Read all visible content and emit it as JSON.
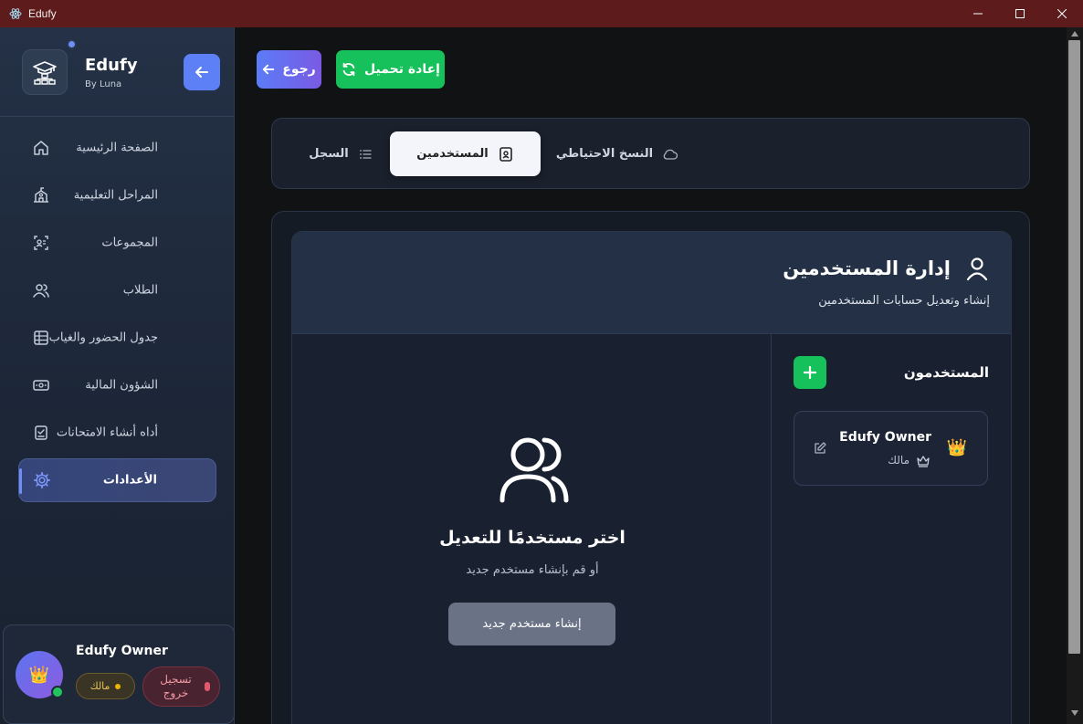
{
  "window": {
    "title": "Edufy"
  },
  "brand": {
    "name": "Edufy",
    "sub": "By Luna"
  },
  "sidebar": {
    "items": [
      {
        "label": "الصفحة الرئيسية",
        "icon": "home-icon",
        "active": false
      },
      {
        "label": "المراحل التعليمية",
        "icon": "school-icon",
        "active": false
      },
      {
        "label": "المجموعات",
        "icon": "groups-icon",
        "active": false
      },
      {
        "label": "الطلاب",
        "icon": "students-icon",
        "active": false
      },
      {
        "label": "جدول الحضور والغياب",
        "icon": "table-icon",
        "active": false
      },
      {
        "label": "الشؤون المالية",
        "icon": "money-icon",
        "active": false
      },
      {
        "label": "أداه أنشاء الامتحانات",
        "icon": "exam-icon",
        "active": false
      },
      {
        "label": "الأعدادات",
        "icon": "gear-icon",
        "active": true
      }
    ]
  },
  "user": {
    "name": "Edufy Owner",
    "role": "مالك",
    "logout": "تسجيل خروج",
    "avatar_icon": "👑"
  },
  "toolbar": {
    "back_label": "رجوع",
    "reload_label": "إعادة تحميل"
  },
  "tabs": [
    {
      "label": "السجل",
      "icon": "list-icon",
      "active": false
    },
    {
      "label": "المستخدمين",
      "icon": "contact-icon",
      "active": true
    },
    {
      "label": "النسخ الاحتياطي",
      "icon": "cloud-icon",
      "active": false
    }
  ],
  "card": {
    "title": "إدارة المستخدمين",
    "subtitle": "إنشاء وتعديل حسابات المستخدمين",
    "list_title": "المستخدمون",
    "users": [
      {
        "name": "Edufy Owner",
        "role": "مالك",
        "crown": "👑"
      }
    ]
  },
  "empty": {
    "title": "اختر مستخدمًا للتعديل",
    "subtitle": "أو قم بإنشاء مستخدم جديد",
    "create_label": "إنشاء مستخدم جديد"
  },
  "colors": {
    "accent": "#5e80f6",
    "success": "#16c05a",
    "titlebar": "#5e1b1b"
  }
}
